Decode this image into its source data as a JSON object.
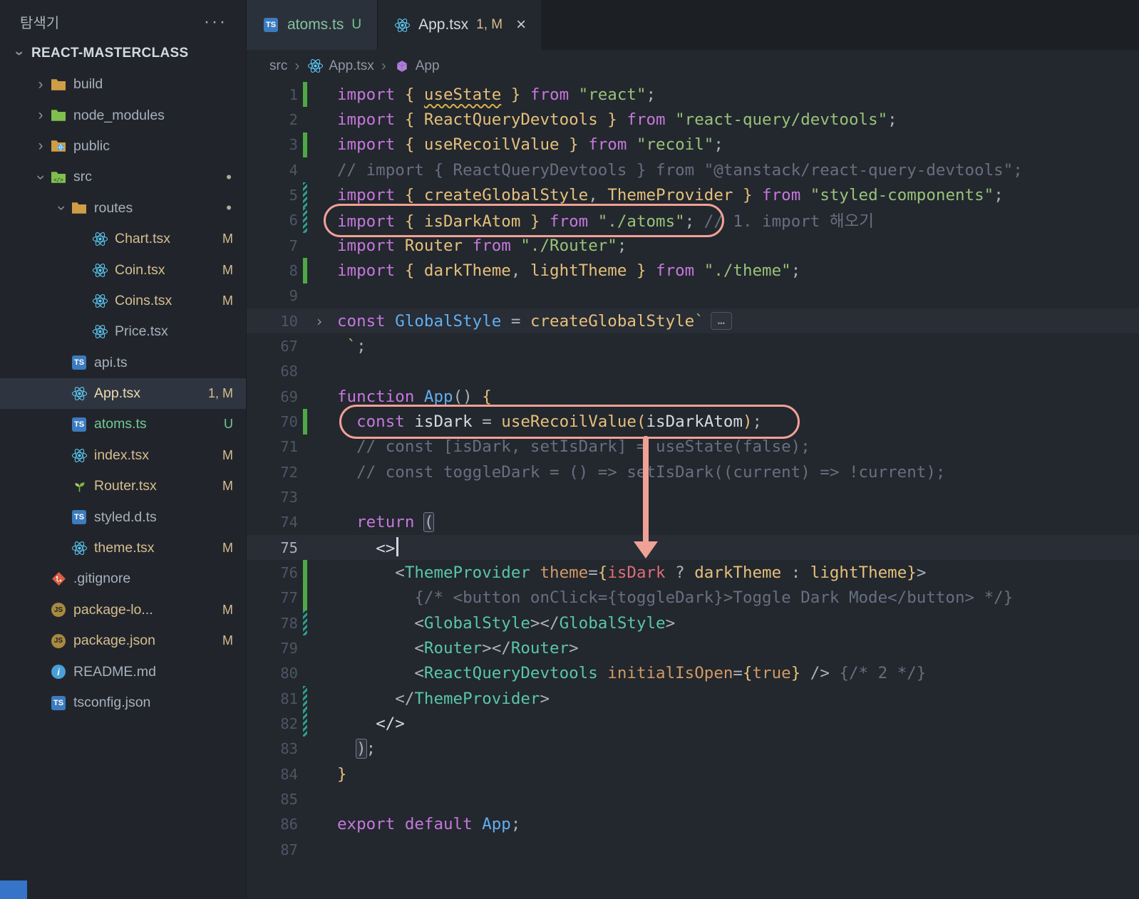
{
  "colors": {
    "editor_bg": "#23272e",
    "sidebar_bg": "#21252b",
    "accent_annotation": "#f0a195",
    "git_modified": "#d6bd8f",
    "git_untracked": "#73c991",
    "keyword": "#c678dd",
    "string": "#98c379",
    "comment": "#667080",
    "jsx_tag": "#58c6ad",
    "attr": "#d19a66"
  },
  "sidebar": {
    "title": "탐색기",
    "actions": "···",
    "project": "REACT-MASTERCLASS",
    "tree": [
      {
        "name": "build",
        "icon": "folder_build",
        "depth": 0,
        "chev": "closed"
      },
      {
        "name": "node_modules",
        "icon": "folder_node",
        "depth": 0,
        "chev": "closed"
      },
      {
        "name": "public",
        "icon": "folder_public",
        "depth": 0,
        "chev": "closed"
      },
      {
        "name": "src",
        "icon": "folder_src",
        "depth": 0,
        "chev": "open",
        "dot": "•"
      },
      {
        "name": "routes",
        "icon": "folder_routes",
        "depth": 1,
        "chev": "open",
        "dot": "•"
      },
      {
        "name": "Chart.tsx",
        "icon": "react",
        "depth": 2,
        "badge": "M",
        "status": "modified"
      },
      {
        "name": "Coin.tsx",
        "icon": "react",
        "depth": 2,
        "badge": "M",
        "status": "modified"
      },
      {
        "name": "Coins.tsx",
        "icon": "react",
        "depth": 2,
        "badge": "M",
        "status": "modified"
      },
      {
        "name": "Price.tsx",
        "icon": "react",
        "depth": 2
      },
      {
        "name": "api.ts",
        "icon": "ts",
        "depth": 1
      },
      {
        "name": "App.tsx",
        "icon": "react",
        "depth": 1,
        "badge": "1, M",
        "status": "modified",
        "selected": true
      },
      {
        "name": "atoms.ts",
        "icon": "ts",
        "depth": 1,
        "badge": "U",
        "status": "untracked"
      },
      {
        "name": "index.tsx",
        "icon": "react",
        "depth": 1,
        "badge": "M",
        "status": "modified"
      },
      {
        "name": "Router.tsx",
        "icon": "seedling",
        "depth": 1,
        "badge": "M",
        "status": "modified"
      },
      {
        "name": "styled.d.ts",
        "icon": "ts",
        "depth": 1
      },
      {
        "name": "theme.tsx",
        "icon": "react",
        "depth": 1,
        "badge": "M",
        "status": "modified"
      },
      {
        "name": ".gitignore",
        "icon": "git",
        "depth": 0
      },
      {
        "name": "package-lo...",
        "icon": "js",
        "depth": 0,
        "badge": "M",
        "status": "modified"
      },
      {
        "name": "package.json",
        "icon": "js",
        "depth": 0,
        "badge": "M",
        "status": "modified"
      },
      {
        "name": "README.md",
        "icon": "info",
        "depth": 0
      },
      {
        "name": "tsconfig.json",
        "icon": "ts",
        "depth": 0
      }
    ]
  },
  "tabs": [
    {
      "icon": "ts",
      "label": "atoms.ts",
      "label_style": "untracked",
      "badge": "U",
      "badge_style": "unt",
      "active": false
    },
    {
      "icon": "react",
      "label": "App.tsx",
      "label_style": "active",
      "badge": "1, M",
      "badge_style": "mod",
      "active": true,
      "close": "×"
    }
  ],
  "breadcrumb": {
    "separator": "›",
    "items": [
      {
        "label": "src"
      },
      {
        "label": "App.tsx",
        "icon": "react"
      },
      {
        "label": "App",
        "icon": "symbol"
      }
    ]
  },
  "editor": {
    "lines": [
      {
        "n": 1,
        "marker": "add",
        "tokens": [
          {
            "s": "k",
            "t": "import "
          },
          {
            "s": "g",
            "t": "{ "
          },
          {
            "s": "u",
            "t": "useState"
          },
          {
            "s": "g",
            "t": " }"
          },
          {
            "s": "k",
            "t": " from "
          },
          {
            "s": "s",
            "t": "\"react\""
          },
          {
            "s": "p",
            "t": ";"
          }
        ]
      },
      {
        "n": 2,
        "tokens": [
          {
            "s": "k",
            "t": "import "
          },
          {
            "s": "g",
            "t": "{ "
          },
          {
            "s": "f",
            "t": "ReactQueryDevtools"
          },
          {
            "s": "g",
            "t": " }"
          },
          {
            "s": "k",
            "t": " from "
          },
          {
            "s": "s",
            "t": "\"react-query/devtools\""
          },
          {
            "s": "p",
            "t": ";"
          }
        ]
      },
      {
        "n": 3,
        "marker": "add",
        "tokens": [
          {
            "s": "k",
            "t": "import "
          },
          {
            "s": "g",
            "t": "{ "
          },
          {
            "s": "f",
            "t": "useRecoilValue"
          },
          {
            "s": "g",
            "t": " }"
          },
          {
            "s": "k",
            "t": " from "
          },
          {
            "s": "s",
            "t": "\"recoil\""
          },
          {
            "s": "p",
            "t": ";"
          }
        ]
      },
      {
        "n": 4,
        "tokens": [
          {
            "s": "c",
            "t": "// import { ReactQueryDevtools } from \"@tanstack/react-query-devtools\";"
          }
        ]
      },
      {
        "n": 5,
        "marker": "mod",
        "tokens": [
          {
            "s": "k",
            "t": "import "
          },
          {
            "s": "g",
            "t": "{ "
          },
          {
            "s": "f",
            "t": "createGlobalStyle"
          },
          {
            "s": "p",
            "t": ", "
          },
          {
            "s": "f",
            "t": "ThemeProvider"
          },
          {
            "s": "g",
            "t": " }"
          },
          {
            "s": "k",
            "t": " from "
          },
          {
            "s": "s",
            "t": "\"styled-components\""
          },
          {
            "s": "p",
            "t": ";"
          }
        ]
      },
      {
        "n": 6,
        "marker": "mod",
        "tokens": [
          {
            "s": "k",
            "t": "import "
          },
          {
            "s": "g",
            "t": "{ "
          },
          {
            "s": "f",
            "t": "isDarkAtom"
          },
          {
            "s": "g",
            "t": " }"
          },
          {
            "s": "k",
            "t": " from "
          },
          {
            "s": "s",
            "t": "\"./atoms\""
          },
          {
            "s": "p",
            "t": "; "
          },
          {
            "s": "c",
            "t": "// 1. import 해오기"
          }
        ]
      },
      {
        "n": 7,
        "tokens": [
          {
            "s": "k",
            "t": "import "
          },
          {
            "s": "f",
            "t": "Router"
          },
          {
            "s": "k",
            "t": " from "
          },
          {
            "s": "s",
            "t": "\"./Router\""
          },
          {
            "s": "p",
            "t": ";"
          }
        ]
      },
      {
        "n": 8,
        "marker": "add",
        "tokens": [
          {
            "s": "k",
            "t": "import "
          },
          {
            "s": "g",
            "t": "{ "
          },
          {
            "s": "f",
            "t": "darkTheme"
          },
          {
            "s": "p",
            "t": ", "
          },
          {
            "s": "f",
            "t": "lightTheme"
          },
          {
            "s": "g",
            "t": " }"
          },
          {
            "s": "k",
            "t": " from "
          },
          {
            "s": "s",
            "t": "\"./theme\""
          },
          {
            "s": "p",
            "t": ";"
          }
        ]
      },
      {
        "n": 9,
        "tokens": []
      },
      {
        "n": 10,
        "fold": true,
        "hl": true,
        "tokens": [
          {
            "s": "k",
            "t": "const "
          },
          {
            "s": "b",
            "t": "GlobalStyle"
          },
          {
            "s": "p",
            "t": " = "
          },
          {
            "s": "f",
            "t": "createGlobalStyle"
          },
          {
            "s": "s",
            "t": "`"
          },
          {
            "s": "e",
            "t": "…"
          }
        ]
      },
      {
        "n": 67,
        "tokens": [
          {
            "s": "p",
            "t": " "
          },
          {
            "s": "s",
            "t": "`"
          },
          {
            "s": "p",
            "t": ";"
          }
        ]
      },
      {
        "n": 68,
        "tokens": []
      },
      {
        "n": 69,
        "tokens": [
          {
            "s": "k",
            "t": "function "
          },
          {
            "s": "b",
            "t": "App"
          },
          {
            "s": "p",
            "t": "() "
          },
          {
            "s": "g",
            "t": "{"
          }
        ]
      },
      {
        "n": 70,
        "marker": "add",
        "tokens": [
          {
            "s": "p",
            "t": "  "
          },
          {
            "s": "k",
            "t": "const "
          },
          {
            "s": "w",
            "t": "isDark"
          },
          {
            "s": "p",
            "t": " = "
          },
          {
            "s": "f",
            "t": "useRecoilValue"
          },
          {
            "s": "g",
            "t": "("
          },
          {
            "s": "w",
            "t": "isDarkAtom"
          },
          {
            "s": "g",
            "t": ")"
          },
          {
            "s": "p",
            "t": ";"
          }
        ]
      },
      {
        "n": 71,
        "tokens": [
          {
            "s": "p",
            "t": "  "
          },
          {
            "s": "c",
            "t": "// const [isDark, setIsDark] = useState(false);"
          }
        ]
      },
      {
        "n": 72,
        "tokens": [
          {
            "s": "p",
            "t": "  "
          },
          {
            "s": "c",
            "t": "// const toggleDark = () => setIsDark((current) => !current);"
          }
        ]
      },
      {
        "n": 73,
        "tokens": []
      },
      {
        "n": 74,
        "tokens": [
          {
            "s": "p",
            "t": "  "
          },
          {
            "s": "k",
            "t": "return "
          },
          {
            "s": "m",
            "t": "("
          }
        ]
      },
      {
        "n": 75,
        "cur": true,
        "hl": true,
        "tokens": [
          {
            "s": "p",
            "t": "    "
          },
          {
            "s": "w",
            "t": "<>"
          },
          {
            "s": "cur",
            "t": ""
          }
        ]
      },
      {
        "n": 76,
        "marker": "add",
        "tokens": [
          {
            "s": "p",
            "t": "      "
          },
          {
            "s": "p",
            "t": "<"
          },
          {
            "s": "t",
            "t": "ThemeProvider"
          },
          {
            "s": "a",
            "t": " theme"
          },
          {
            "s": "p",
            "t": "="
          },
          {
            "s": "g",
            "t": "{"
          },
          {
            "s": "r",
            "t": "isDark"
          },
          {
            "s": "p",
            "t": " ? "
          },
          {
            "s": "f",
            "t": "darkTheme"
          },
          {
            "s": "p",
            "t": " : "
          },
          {
            "s": "f",
            "t": "lightTheme"
          },
          {
            "s": "g",
            "t": "}"
          },
          {
            "s": "p",
            "t": ">"
          }
        ]
      },
      {
        "n": 77,
        "marker": "add",
        "tokens": [
          {
            "s": "p",
            "t": "        "
          },
          {
            "s": "c",
            "t": "{/* <button onClick={toggleDark}>Toggle Dark Mode</button> */}"
          }
        ]
      },
      {
        "n": 78,
        "marker": "mod",
        "tokens": [
          {
            "s": "p",
            "t": "        "
          },
          {
            "s": "p",
            "t": "<"
          },
          {
            "s": "t",
            "t": "GlobalStyle"
          },
          {
            "s": "p",
            "t": "></"
          },
          {
            "s": "t",
            "t": "GlobalStyle"
          },
          {
            "s": "p",
            "t": ">"
          }
        ]
      },
      {
        "n": 79,
        "tokens": [
          {
            "s": "p",
            "t": "        "
          },
          {
            "s": "p",
            "t": "<"
          },
          {
            "s": "t",
            "t": "Router"
          },
          {
            "s": "p",
            "t": "></"
          },
          {
            "s": "t",
            "t": "Router"
          },
          {
            "s": "p",
            "t": ">"
          }
        ]
      },
      {
        "n": 80,
        "tokens": [
          {
            "s": "p",
            "t": "        "
          },
          {
            "s": "p",
            "t": "<"
          },
          {
            "s": "t",
            "t": "ReactQueryDevtools"
          },
          {
            "s": "a",
            "t": " initialIsOpen"
          },
          {
            "s": "p",
            "t": "="
          },
          {
            "s": "g",
            "t": "{"
          },
          {
            "s": "a",
            "t": "true"
          },
          {
            "s": "g",
            "t": "}"
          },
          {
            "s": "p",
            "t": " /> "
          },
          {
            "s": "c",
            "t": "{/* 2 */}"
          }
        ]
      },
      {
        "n": 81,
        "marker": "mod",
        "tokens": [
          {
            "s": "p",
            "t": "      "
          },
          {
            "s": "p",
            "t": "</"
          },
          {
            "s": "t",
            "t": "ThemeProvider"
          },
          {
            "s": "p",
            "t": ">"
          }
        ]
      },
      {
        "n": 82,
        "marker": "mod",
        "tokens": [
          {
            "s": "p",
            "t": "    "
          },
          {
            "s": "w",
            "t": "</>"
          }
        ]
      },
      {
        "n": 83,
        "tokens": [
          {
            "s": "p",
            "t": "  "
          },
          {
            "s": "m",
            "t": ")"
          },
          {
            "s": "p",
            "t": ";"
          }
        ]
      },
      {
        "n": 84,
        "tokens": [
          {
            "s": "g",
            "t": "}"
          }
        ]
      },
      {
        "n": 85,
        "tokens": []
      },
      {
        "n": 86,
        "tokens": [
          {
            "s": "k",
            "t": "export "
          },
          {
            "s": "k",
            "t": "default "
          },
          {
            "s": "b",
            "t": "App"
          },
          {
            "s": "p",
            "t": ";"
          }
        ]
      },
      {
        "n": 87,
        "tokens": []
      }
    ]
  },
  "annotations": {
    "color": "#f0a195",
    "items": [
      {
        "type": "ellipse",
        "label": "highlight import isDarkAtom (line 6)"
      },
      {
        "type": "ellipse",
        "label": "highlight useRecoilValue(isDarkAtom) (line 70)"
      },
      {
        "type": "arrow",
        "label": "arrow pointing to theme={isDark ...} (line 76)"
      }
    ]
  }
}
